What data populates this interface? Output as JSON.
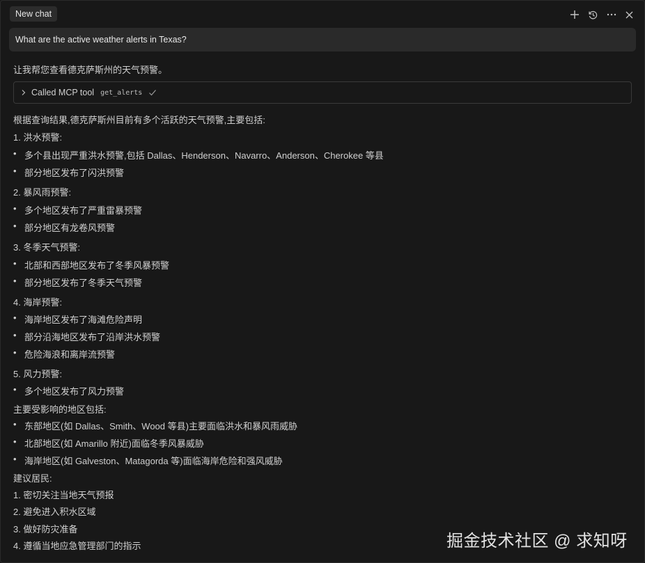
{
  "header": {
    "tab_label": "New chat"
  },
  "query": "What are the active weather alerts in Texas?",
  "intro": "让我帮您查看德克萨斯州的天气预警。",
  "tool_call": {
    "label": "Called MCP tool",
    "name": "get_alerts"
  },
  "summary": "根据查询结果,德克萨斯州目前有多个活跃的天气预警,主要包括:",
  "sections": [
    {
      "heading": "1. 洪水预警:",
      "items": [
        "多个县出现严重洪水预警,包括 Dallas、Henderson、Navarro、Anderson、Cherokee 等县",
        "部分地区发布了闪洪预警"
      ]
    },
    {
      "heading": "2. 暴风雨预警:",
      "items": [
        "多个地区发布了严重雷暴预警",
        "部分地区有龙卷风预警"
      ]
    },
    {
      "heading": "3. 冬季天气预警:",
      "items": [
        "北部和西部地区发布了冬季风暴预警",
        "部分地区发布了冬季天气预警"
      ]
    },
    {
      "heading": "4. 海岸预警:",
      "items": [
        "海岸地区发布了海滩危险声明",
        "部分沿海地区发布了沿岸洪水预警",
        "危险海浪和离岸流预警"
      ]
    },
    {
      "heading": "5. 风力预警:",
      "items": [
        "多个地区发布了风力预警"
      ]
    }
  ],
  "affected": {
    "heading": "主要受影响的地区包括:",
    "items": [
      "东部地区(如 Dallas、Smith、Wood 等县)主要面临洪水和暴风雨威胁",
      "北部地区(如 Amarillo 附近)面临冬季风暴威胁",
      "海岸地区(如 Galveston、Matagorda 等)面临海岸危险和强风威胁"
    ]
  },
  "advice": {
    "heading": "建议居民:",
    "items": [
      "1. 密切关注当地天气预报",
      "2. 避免进入积水区域",
      "3. 做好防灾准备",
      "4. 遵循当地应急管理部门的指示"
    ]
  },
  "watermark": "掘金技术社区 @ 求知呀",
  "icons": {
    "add": "plus-icon",
    "history": "history-icon",
    "more": "ellipsis-icon",
    "close": "close-icon",
    "expand": "chevron-right-icon",
    "done": "check-icon"
  }
}
